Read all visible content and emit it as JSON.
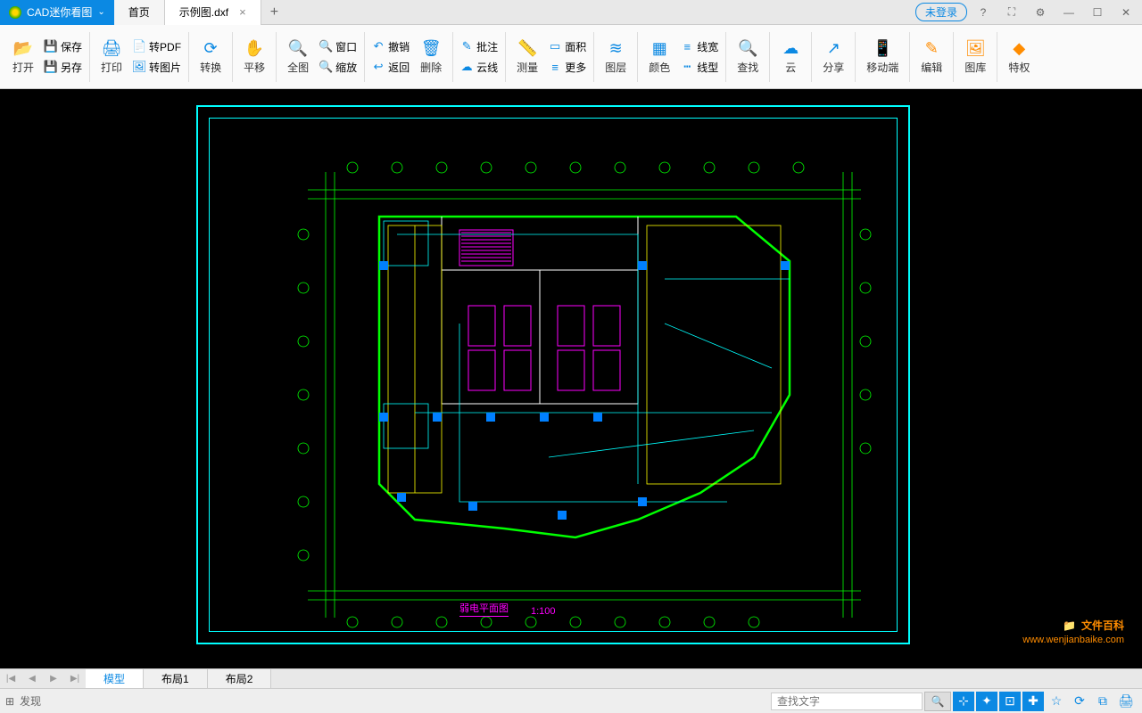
{
  "app_title": "CAD迷你看图",
  "tabs": {
    "home": "首页",
    "file": "示例图.dxf"
  },
  "login": "未登录",
  "toolbar": {
    "open": "打开",
    "save": "保存",
    "saveas": "另存",
    "print": "打印",
    "topdf": "转PDF",
    "toimg": "转图片",
    "convert": "转换",
    "pan": "平移",
    "full": "全图",
    "window": "窗口",
    "zoom": "缩放",
    "undo": "撤销",
    "back": "返回",
    "delete": "删除",
    "annotate": "批注",
    "cloud": "云线",
    "measure": "测量",
    "area": "面积",
    "more": "更多",
    "layer": "图层",
    "color": "颜色",
    "linewidth": "线宽",
    "linetype": "线型",
    "find": "查找",
    "cloudstore": "云",
    "share": "分享",
    "mobile": "移动端",
    "edit": "编辑",
    "library": "图库",
    "vip": "特权"
  },
  "footer_tabs": {
    "model": "模型",
    "layout1": "布局1",
    "layout2": "布局2"
  },
  "status": {
    "discover": "发现",
    "search_placeholder": "查找文字"
  },
  "drawing": {
    "title": "弱电平面图",
    "scale": "1:100"
  },
  "watermark": {
    "main": "文件百科",
    "url": "www.wenjianbaike.com"
  }
}
